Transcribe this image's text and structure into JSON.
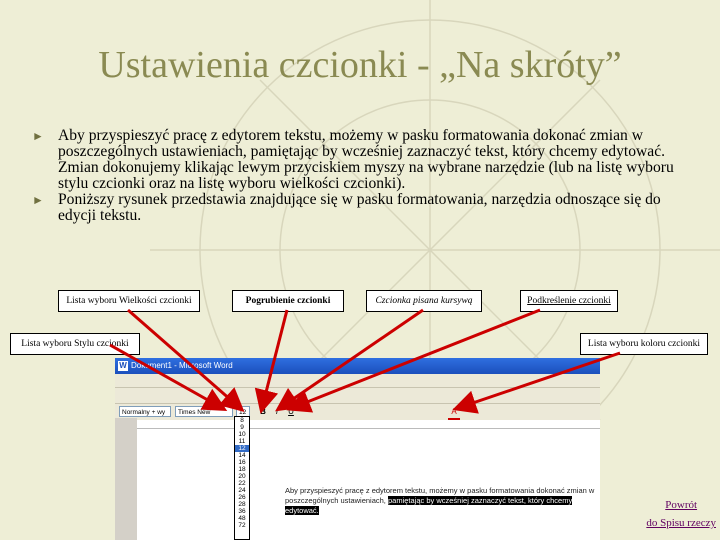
{
  "slide": {
    "title": "Ustawienia czcionki - „Na skróty”",
    "bullets": [
      "Aby przyspieszyć pracę z edytorem tekstu, możemy w pasku formatowania dokonać zmian w poszczególnych ustawieniach, pamiętając by wcześniej zaznaczyć tekst, który chcemy edytować.  Zmian dokonujemy klikając lewym przyciskiem myszy na wybrane narzędzie (lub na listę wyboru stylu czcionki oraz na listę wyboru wielkości czcionki).",
      "Poniższy rysunek przedstawia znajdujące się w pasku formatowania, narzędzia odnoszące się do edycji tekstu."
    ],
    "bullet_marker": "►"
  },
  "labels": {
    "size_list": "Lista wyboru Wielkości czcionki",
    "bold": "Pogrubienie czcionki",
    "italic": "Czcionka pisana kursywą",
    "underline": "Podkreślenie czcionki",
    "style_list": "Lista wyboru Stylu czcionki",
    "color_list": "Lista wyboru koloru czcionki"
  },
  "screenshot": {
    "window_title": "Dokument1 - Microsoft Word",
    "style_value": "Normalny + wy",
    "font_value": "Times New Roman",
    "font_sizes": [
      "8",
      "9",
      "10",
      "11",
      "12",
      "14",
      "16",
      "18",
      "20",
      "22",
      "24",
      "26",
      "28",
      "36",
      "48",
      "72"
    ],
    "selected_size": "12",
    "toolbar_bold": "B",
    "toolbar_italic": "I",
    "toolbar_underline": "U",
    "toolbar_color": "A",
    "doc_text_plain_1": "Aby przyspieszyć pracę z edytorem tekstu, możemy w pasku formatowania dokonać zmian w poszczególnych ustawieniach, ",
    "doc_text_highlight_1": "pamiętając by wcześniej zaznaczyć tekst, który chcemy edytować."
  },
  "nav": {
    "back_line1": "Powrót",
    "back_line2": "do Spisu rzeczy"
  },
  "colors": {
    "title": "#8a8a52",
    "background": "#eeeed6",
    "arrow": "#cc0000",
    "link": "#600060"
  }
}
